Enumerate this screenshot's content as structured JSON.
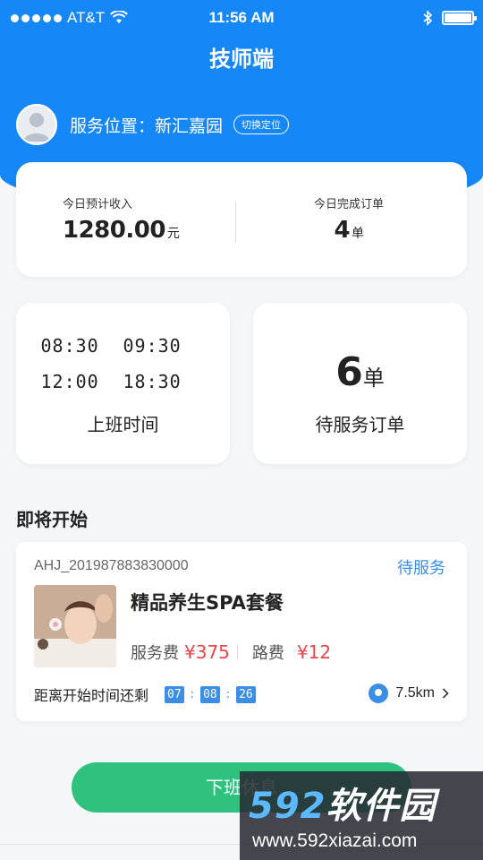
{
  "status_bar": {
    "carrier": "AT&T",
    "time": "11:56 AM"
  },
  "header": {
    "title": "技师端"
  },
  "location": {
    "label": "服务位置：新汇嘉园",
    "relocate_label": "切换定位"
  },
  "income": {
    "today_income_label": "今日预计收入",
    "today_income_value": "1280.00",
    "today_income_unit": "元",
    "today_orders_label": "今日完成订单",
    "today_orders_value": "4",
    "today_orders_unit": "单"
  },
  "shift": {
    "times": [
      "08:30",
      "09:30",
      "12:00",
      "18:30"
    ],
    "caption": "上班时间"
  },
  "pending": {
    "count": "6",
    "unit": "单",
    "caption": "待服务订单"
  },
  "upcoming": {
    "section_title": "即将开始",
    "order_no": "AHJ_201987883830000",
    "status": "待服务",
    "package_name": "精品养生SPA套餐",
    "service_fee_label": "服务费",
    "service_fee": "¥375",
    "travel_fee_label": "路费",
    "travel_fee": "¥12",
    "countdown_label": "距离开始时间还剩",
    "countdown": {
      "h": "07",
      "m": "08",
      "s": "26"
    },
    "distance": "7.5km"
  },
  "actions": {
    "off_work_label": "下班休息"
  },
  "watermark": {
    "logo_num": "592",
    "logo_text": "软件园",
    "url": "www.592xiazai.com"
  },
  "colors": {
    "primary": "#1687f7",
    "accent_blue": "#3a8ee6",
    "price_red": "#f0424b",
    "button_green": "#2ec27e"
  }
}
